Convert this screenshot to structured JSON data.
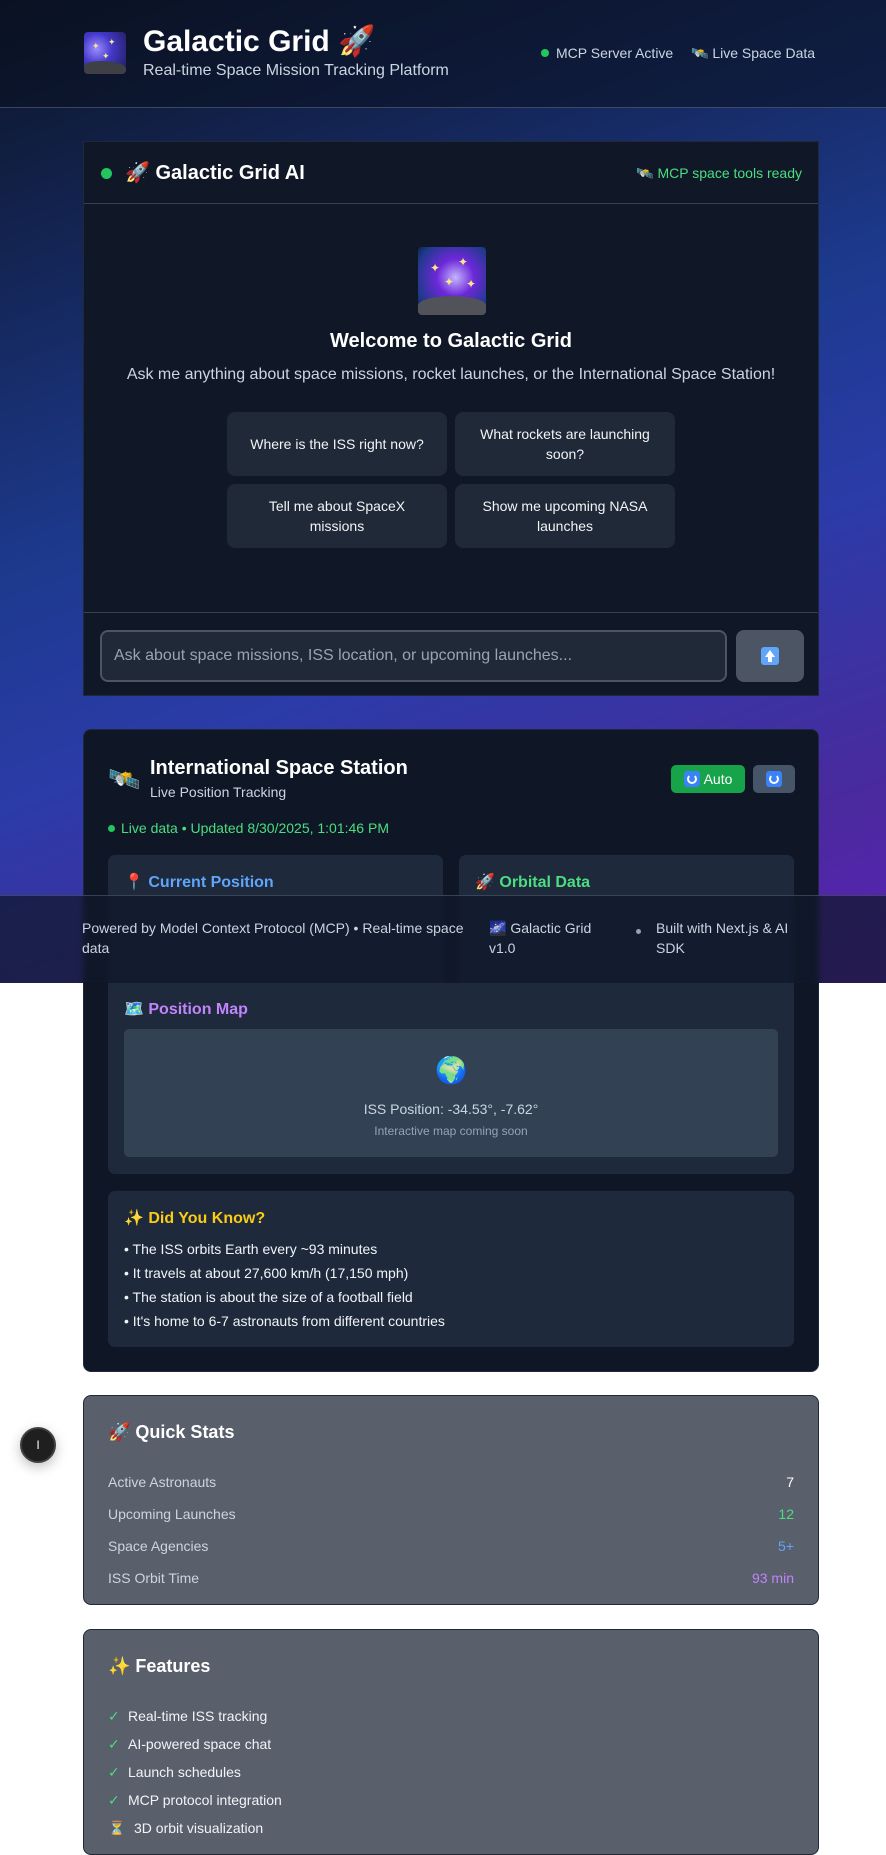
{
  "header": {
    "title": "Galactic Grid 🚀",
    "subtitle": "Real-time Space Mission Tracking Platform",
    "status_mcp": "MCP Server Active",
    "status_live": "🛰️ Live Space Data"
  },
  "chat": {
    "title": "🚀 Galactic Grid AI",
    "ready": "🛰️ MCP space tools ready",
    "welcome_title": "Welcome to Galactic Grid",
    "welcome_text": "Ask me anything about space missions, rocket launches, or the International Space Station!",
    "suggestions": [
      "Where is the ISS right now?",
      "What rockets are launching soon?",
      "Tell me about SpaceX missions",
      "Show me upcoming NASA launches"
    ],
    "input_placeholder": "Ask about space missions, ISS location, or upcoming launches...",
    "input_value": ""
  },
  "iss": {
    "icon": "🛰️",
    "title": "International Space Station",
    "subtitle": "Live Position Tracking",
    "auto_label": "Auto",
    "live_text": "Live data • Updated 8/30/2025, 1:01:46 PM",
    "current_position_title": "📍 Current Position",
    "orbital_data_title": "🚀 Orbital Data",
    "map_title": "🗺️ Position Map",
    "map_globe": "🌍",
    "map_position": "ISS Position: -34.53°, -7.62°",
    "map_note": "Interactive map coming soon",
    "facts_title": "✨ Did You Know?",
    "facts": [
      "• The ISS orbits Earth every ~93 minutes",
      "• It travels at about 27,600 km/h (17,150 mph)",
      "• The station is about the size of a football field",
      "• It's home to 6-7 astronauts from different countries"
    ]
  },
  "footer": {
    "powered_line1": "Powered by Model Context Protocol (MCP) • Real-time space",
    "powered_line2": "data",
    "version_line1": "🌌 Galactic Grid",
    "version_line2": "v1.0",
    "built_line1": "Built with Next.js & AI",
    "built_line2": "SDK"
  },
  "quick_stats": {
    "title": "🚀 Quick Stats",
    "rows": [
      {
        "label": "Active Astronauts",
        "value": "7",
        "color": "#ffffff"
      },
      {
        "label": "Upcoming Launches",
        "value": "12",
        "color": "#4ade80"
      },
      {
        "label": "Space Agencies",
        "value": "5+",
        "color": "#60a5fa"
      },
      {
        "label": "ISS Orbit Time",
        "value": "93 min",
        "color": "#c084fc"
      }
    ]
  },
  "features": {
    "title": "✨ Features",
    "items": [
      {
        "mark": "✓",
        "label": "Real-time ISS tracking"
      },
      {
        "mark": "✓",
        "label": "AI-powered space chat"
      },
      {
        "mark": "✓",
        "label": "Launch schedules"
      },
      {
        "mark": "✓",
        "label": "MCP protocol integration"
      },
      {
        "mark": "⏳",
        "label": "3D orbit visualization"
      }
    ]
  },
  "side_button": {
    "label": "I"
  },
  "colors": {
    "accent_green": "#22c55e",
    "position_blue": "#60a5fa",
    "orbital_green": "#4ade80",
    "map_purple": "#c084fc",
    "facts_yellow": "#facc15"
  }
}
